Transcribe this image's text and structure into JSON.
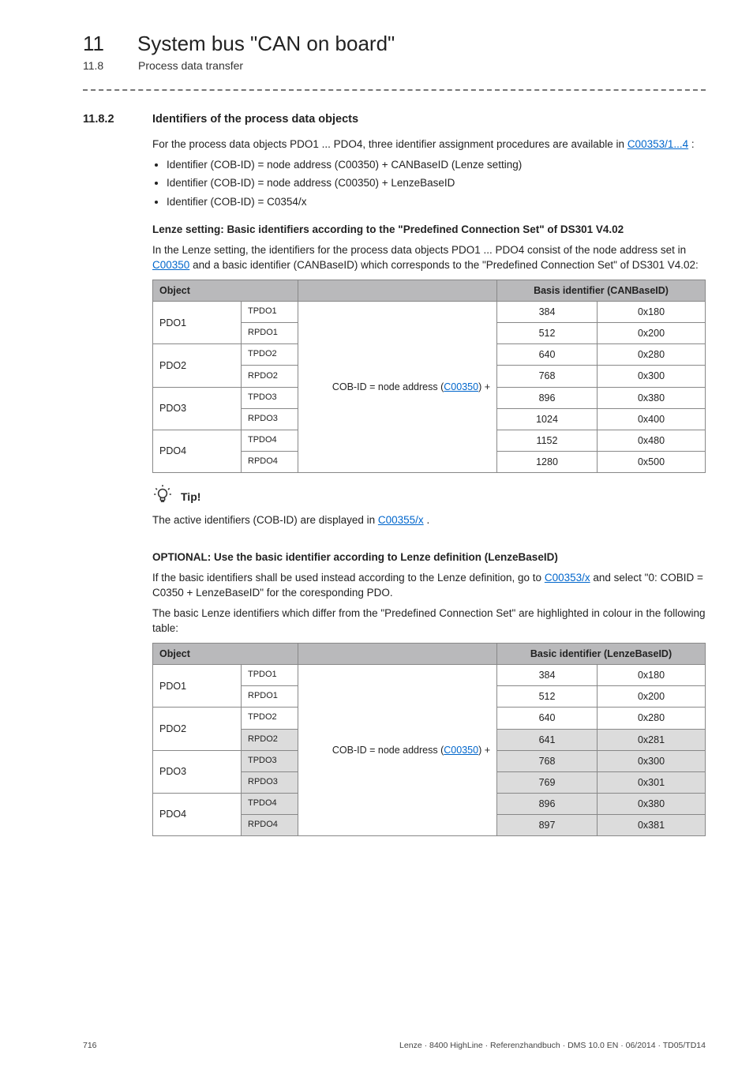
{
  "chapter": {
    "num": "11",
    "title": "System bus \"CAN on board\""
  },
  "section": {
    "num": "11.8",
    "title": "Process data transfer"
  },
  "heading": {
    "num": "11.8.2",
    "title": "Identifiers of the process data objects"
  },
  "intro": {
    "p1_a": "For the process data objects PDO1 ... PDO4, three identifier assignment procedures are available in ",
    "p1_link": "C00353/1...4",
    "p1_b": " :",
    "bullets": [
      "Identifier (COB-ID) = node address (C00350) + CANBaseID (Lenze setting)",
      "Identifier (COB-ID) = node address (C00350) + LenzeBaseID",
      "Identifier (COB-ID) = C0354/x"
    ]
  },
  "lenze": {
    "subhead": "Lenze setting: Basic identifiers according to the \"Predefined Connection Set\" of DS301 V4.02",
    "para_a": "In the Lenze setting, the identifiers for the process data objects PDO1 ... PDO4 consist of the node address set in ",
    "para_link": "C00350",
    "para_b": " and a basic identifier (CANBaseID) which corresponds to the \"Predefined Connection Set\" of DS301 V4.02:",
    "table": {
      "head_object": "Object",
      "head_basis": "Basis identifier (CANBaseID)",
      "formula_a": "COB-ID = node address (",
      "formula_link": "C00350",
      "formula_b": ") +",
      "rows": [
        {
          "obj": "PDO1",
          "sub": "TPDO1",
          "num": "384",
          "hex": "0x180"
        },
        {
          "obj": "",
          "sub": "RPDO1",
          "num": "512",
          "hex": "0x200"
        },
        {
          "obj": "PDO2",
          "sub": "TPDO2",
          "num": "640",
          "hex": "0x280"
        },
        {
          "obj": "",
          "sub": "RPDO2",
          "num": "768",
          "hex": "0x300"
        },
        {
          "obj": "PDO3",
          "sub": "TPDO3",
          "num": "896",
          "hex": "0x380"
        },
        {
          "obj": "",
          "sub": "RPDO3",
          "num": "1024",
          "hex": "0x400"
        },
        {
          "obj": "PDO4",
          "sub": "TPDO4",
          "num": "1152",
          "hex": "0x480"
        },
        {
          "obj": "",
          "sub": "RPDO4",
          "num": "1280",
          "hex": "0x500"
        }
      ]
    }
  },
  "tip": {
    "label": "Tip!",
    "text_a": "The active identifiers (COB-ID) are displayed in ",
    "text_link": "C00355/x",
    "text_b": "."
  },
  "optional": {
    "subhead": "OPTIONAL: Use the basic identifier according to Lenze definition (LenzeBaseID)",
    "p1_a": "If the basic identifiers shall be used instead according to the Lenze definition, go to ",
    "p1_link": "C00353/x",
    "p1_b": " and select \"0: COBID = C0350 + LenzeBaseID\" for the coresponding PDO.",
    "p2": "The basic Lenze identifiers which differ from the \"Predefined Connection Set\" are highlighted in colour in the following table:",
    "table": {
      "head_object": "Object",
      "head_basic": "Basic identifier (LenzeBaseID)",
      "formula_a": "COB-ID = node address (",
      "formula_link": "C00350",
      "formula_b": ") +",
      "rows": [
        {
          "obj": "PDO1",
          "sub": "TPDO1",
          "num": "384",
          "hex": "0x180",
          "hl": false
        },
        {
          "obj": "",
          "sub": "RPDO1",
          "num": "512",
          "hex": "0x200",
          "hl": false
        },
        {
          "obj": "PDO2",
          "sub": "TPDO2",
          "num": "640",
          "hex": "0x280",
          "hl": false
        },
        {
          "obj": "",
          "sub": "RPDO2",
          "num": "641",
          "hex": "0x281",
          "hl": true
        },
        {
          "obj": "PDO3",
          "sub": "TPDO3",
          "num": "768",
          "hex": "0x300",
          "hl": true
        },
        {
          "obj": "",
          "sub": "RPDO3",
          "num": "769",
          "hex": "0x301",
          "hl": true
        },
        {
          "obj": "PDO4",
          "sub": "TPDO4",
          "num": "896",
          "hex": "0x380",
          "hl": true
        },
        {
          "obj": "",
          "sub": "RPDO4",
          "num": "897",
          "hex": "0x381",
          "hl": true
        }
      ]
    }
  },
  "footer": {
    "page": "716",
    "meta": "Lenze · 8400 HighLine · Referenzhandbuch · DMS 10.0 EN · 06/2014 · TD05/TD14"
  }
}
